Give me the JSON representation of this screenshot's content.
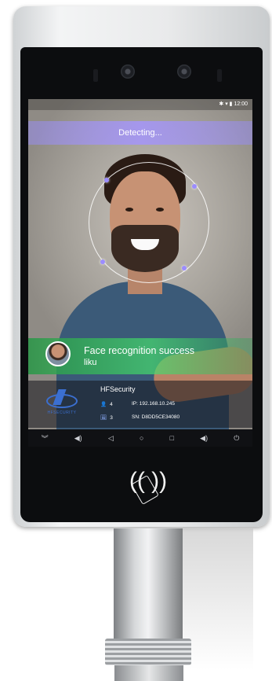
{
  "status_bar": {
    "icons": "✱ ▾ ▮ 12:00"
  },
  "detect_banner": {
    "text": "Detecting..."
  },
  "recognition": {
    "title": "Face recognition success",
    "name": "liku"
  },
  "info_panel": {
    "company": "HFSecurity",
    "logo_text": "HFSECURITY",
    "users_count": "4",
    "faces_count": "3",
    "ip": "IP: 192.168.10.245",
    "serial": "SN: D8DD5CE34080",
    "user_icon": "👤",
    "face_icon": "🖼"
  },
  "navbar": {
    "items": [
      "︾",
      "◀)",
      "◁",
      "○",
      "□",
      "◀)",
      "⏻"
    ]
  },
  "rfid": {
    "symbol": "((  ))"
  },
  "colors": {
    "detect": "#a596f5",
    "success": "#46dc6e",
    "tracking_dot": "#9b8cff"
  }
}
